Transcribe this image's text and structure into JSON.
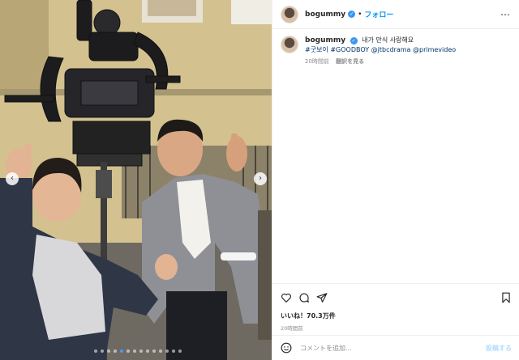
{
  "post": {
    "username": "bogummy",
    "follow_separator": "•",
    "follow_label": "フォロー",
    "more_icon": "more-horizontal-icon",
    "caption": "내가 만식 사랑해요",
    "hashtags": [
      "#굿보이",
      "#GOODBOY"
    ],
    "mentions": [
      "@jtbcdrama",
      "@primevideo"
    ],
    "comment_time": "20時間前",
    "translate_label": "翻訳を見る",
    "likes": "いいね！70.3万件",
    "post_time": "20時間前",
    "comment_placeholder": "コメントを追加...",
    "post_button_label": "投稿する"
  },
  "carousel": {
    "slide_count": 14,
    "active_slide": 4
  },
  "colors": {
    "accent": "#0095f6",
    "link": "#00376b",
    "verified": "#3897f0"
  }
}
